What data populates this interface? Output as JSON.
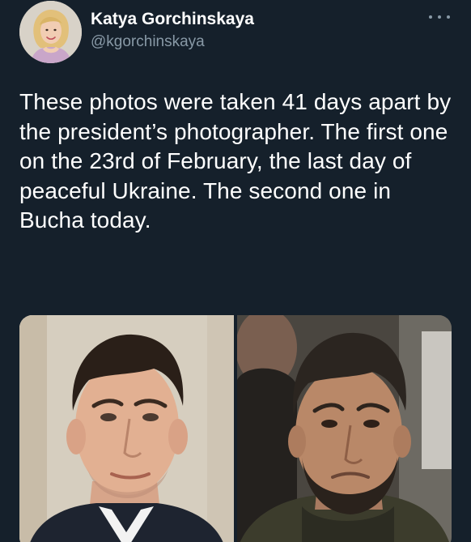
{
  "author": {
    "name": "Katya Gorchinskaya",
    "handle": "@kgorchinskaya"
  },
  "tweet": {
    "text": "These photos were taken 41 days apart by the president’s photographer. The first one on the 23rd of February, the last day of peaceful Ukraine. The second one in Bucha today."
  },
  "icons": {
    "more": "more-options-icon",
    "avatar": "profile-avatar"
  },
  "colors": {
    "background": "#15202b",
    "primary_text": "#ffffff",
    "secondary_text": "#8899a6"
  }
}
